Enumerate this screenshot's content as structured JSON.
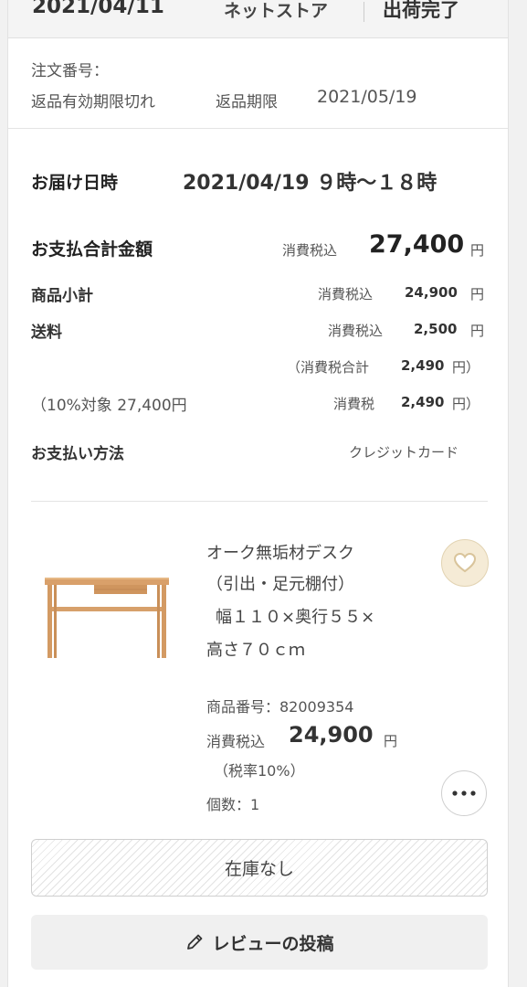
{
  "header": {
    "date": "2021/04/11",
    "store": "ネットストア",
    "status": "出荷完了"
  },
  "order": {
    "number_label": "注文番号：",
    "return_status": "返品有効期限切れ",
    "return_deadline_label": "返品期限",
    "return_deadline": "2021/05/19"
  },
  "delivery": {
    "label": "お届け日時",
    "value": "2021/04/19 ９時〜１８時"
  },
  "payment": {
    "total_label": "お支払合計金額",
    "total_tax_label": "消費税込",
    "total_value": "27,400",
    "subtotal_label": "商品小計",
    "subtotal_tax_label": "消費税込",
    "subtotal_value": "24,900",
    "shipping_label": "送料",
    "shipping_tax_label": "消費税込",
    "shipping_value": "2,500",
    "tax_total_open": "（消費税合計",
    "tax_total_value": "2,490",
    "tax_total_close": "円）",
    "tax_target": "（10%対象 27,400円",
    "tax_label": "消費税",
    "tax_value": "2,490",
    "tax_close": "円）",
    "method_label": "お支払い方法",
    "method_value": "クレジットカード",
    "yen": "円"
  },
  "product": {
    "name_line1": "オーク無垢材デスク",
    "name_line2": "（引出・足元棚付）",
    "name_line3": "幅１１０×奥行５５×",
    "name_line4": "高さ７０ｃｍ",
    "number_label": "商品番号：82009354",
    "price_tax_label": "消費税込",
    "price_value": "24,900",
    "yen": "円",
    "tax_rate": "（税率10%）",
    "quantity": "個数：1"
  },
  "buttons": {
    "stock": "在庫なし",
    "review": "レビューの投稿"
  },
  "icons": {
    "favorite": "heart-icon",
    "more": "more-dots-icon",
    "review": "pencil-icon"
  },
  "colors": {
    "favorite_bg": "#f5ebd6",
    "favorite_heart": "#d9c49b"
  }
}
